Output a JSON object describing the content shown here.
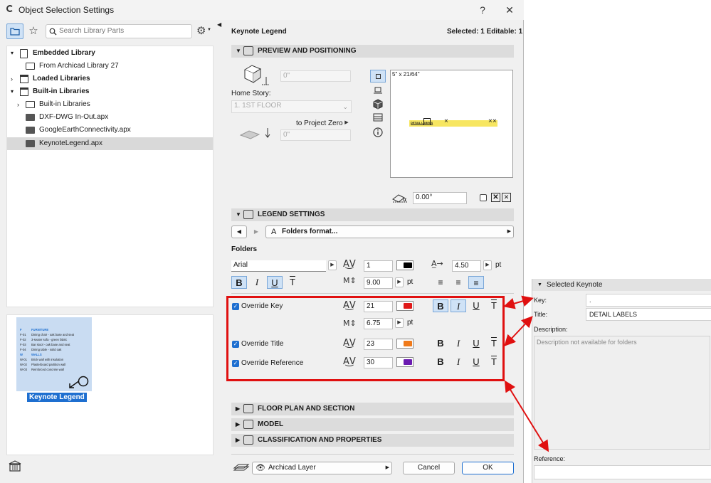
{
  "dialog": {
    "title": "Object Selection Settings",
    "help": "?",
    "close": "✕"
  },
  "left": {
    "search_placeholder": "Search Library Parts",
    "tree": [
      {
        "label": "Embedded Library"
      },
      {
        "label": "From Archicad Library 27"
      },
      {
        "label": "Loaded Libraries"
      },
      {
        "label": "Built-in Libraries"
      },
      {
        "label": "Built-in Libraries"
      },
      {
        "label": "DXF-DWG In-Out.apx"
      },
      {
        "label": "GoogleEarthConnectivity.apx"
      },
      {
        "label": "KeynoteLegend.apx"
      }
    ],
    "thumb_label": "Keynote Legend",
    "thumb_lines": [
      {
        "code": "F",
        "text": "FURNITURE"
      },
      {
        "code": "F-01",
        "text": "Dining chair - oak base and seat"
      },
      {
        "code": "F-02",
        "text": "3-seater sofa - green fabric"
      },
      {
        "code": "F-03",
        "text": "Bar stool - oak base and seat"
      },
      {
        "code": "F-04",
        "text": "Dining table - solid oak"
      },
      {
        "code": "W",
        "text": "WALLS"
      },
      {
        "code": "W-01",
        "text": "Brick wall with insulation"
      },
      {
        "code": "W-02",
        "text": "Plasterboard partition wall"
      },
      {
        "code": "W-03",
        "text": "Reinforced concrete wall"
      }
    ]
  },
  "right": {
    "object_name": "Keynote Legend",
    "selected_info": "Selected: 1 Editable: 1",
    "preview_section": "PREVIEW AND POSITIONING",
    "elevation_top": "0\"",
    "home_story_label": "Home Story:",
    "home_story_value": "1. 1ST FLOOR",
    "to_project_zero": "to Project Zero",
    "elevation_bottom": "0\"",
    "preview_size": "5\" x 21/64\"",
    "preview_text": "DETAIL LABELS",
    "angle": "0.00°",
    "legend_section": "LEGEND SETTINGS",
    "folders_format": "Folders format...",
    "folders_heading": "Folders",
    "font": "Arial",
    "pen": "1",
    "size_value": "4.50",
    "size_unit": "pt",
    "spacing": "9.00",
    "spacing_unit": "pt",
    "override_key": "Override Key",
    "override_key_pen": "21",
    "override_key_spacing": "6.75",
    "override_key_unit": "pt",
    "override_title": "Override Title",
    "override_title_pen": "23",
    "override_reference": "Override Reference",
    "override_reference_pen": "30",
    "floor_plan_section": "FLOOR PLAN AND SECTION",
    "model_section": "MODEL",
    "classification_section": "CLASSIFICATION AND PROPERTIES",
    "layer": "Archicad Layer",
    "cancel": "Cancel",
    "ok": "OK"
  },
  "format_glyphs": {
    "bold": "B",
    "italic": "I",
    "underline": "U",
    "strike": "T"
  },
  "colors": {
    "key_pen": "#e01a1a",
    "title_pen": "#f07a1a",
    "reference_pen": "#6a1ab0",
    "folder_pen": "#000000",
    "highlight_box": "#e01010",
    "accent": "#1e6fd0"
  },
  "side_panel": {
    "header": "Selected Keynote",
    "key_label": "Key:",
    "key_value": ".",
    "title_label": "Title:",
    "title_value": "DETAIL LABELS",
    "description_label": "Description:",
    "description_value": "Description not available for folders",
    "reference_label": "Reference:"
  }
}
